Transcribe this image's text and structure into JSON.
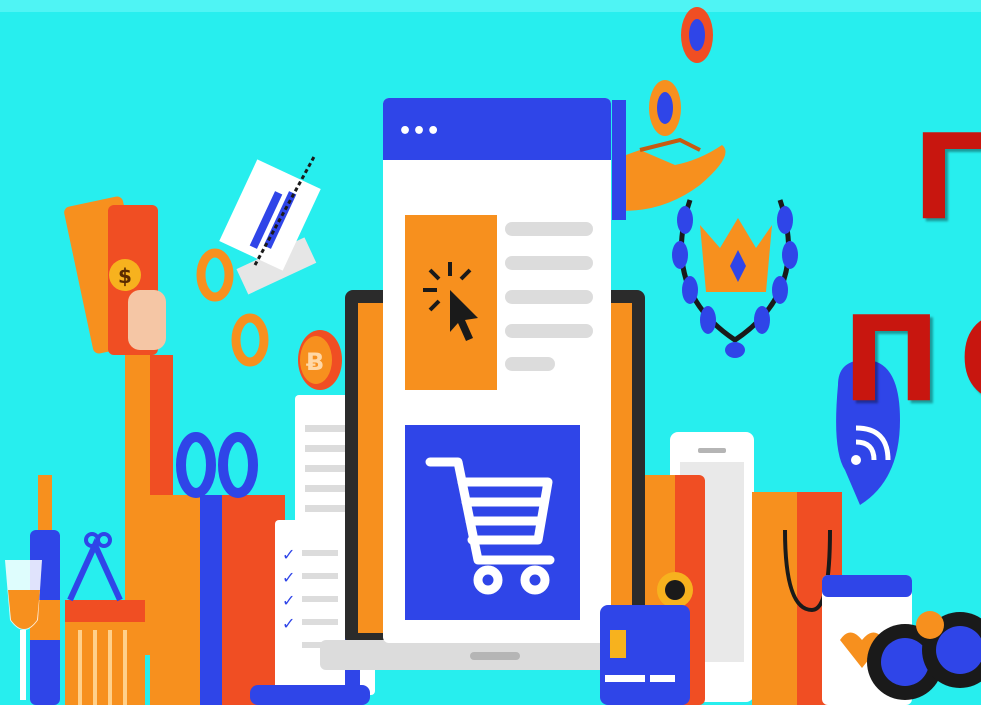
{
  "banner": {
    "headline_line1": "Г",
    "headline_line2": "ПО",
    "browser_dots": "•••",
    "coin_symbol": "Ƀ"
  },
  "colors": {
    "background": "#27eeee",
    "orange": "#f7901e",
    "deep_orange": "#f04e23",
    "blue": "#2f45e8",
    "headline": "#c8160f",
    "white": "#ffffff"
  },
  "icons": [
    "money-icon",
    "scissors-icon",
    "bitcoin-coin-icon",
    "gift-box-icon",
    "basket-icon",
    "wine-icon",
    "receipt-icon",
    "checklist-icon",
    "phone-icon",
    "click-cursor-icon",
    "shopping-cart-icon",
    "crown-icon",
    "laurel-icon",
    "hand-coins-icon",
    "chat-wifi-icon",
    "binoculars-icon",
    "credit-card-icon",
    "shopping-bag-icon"
  ]
}
